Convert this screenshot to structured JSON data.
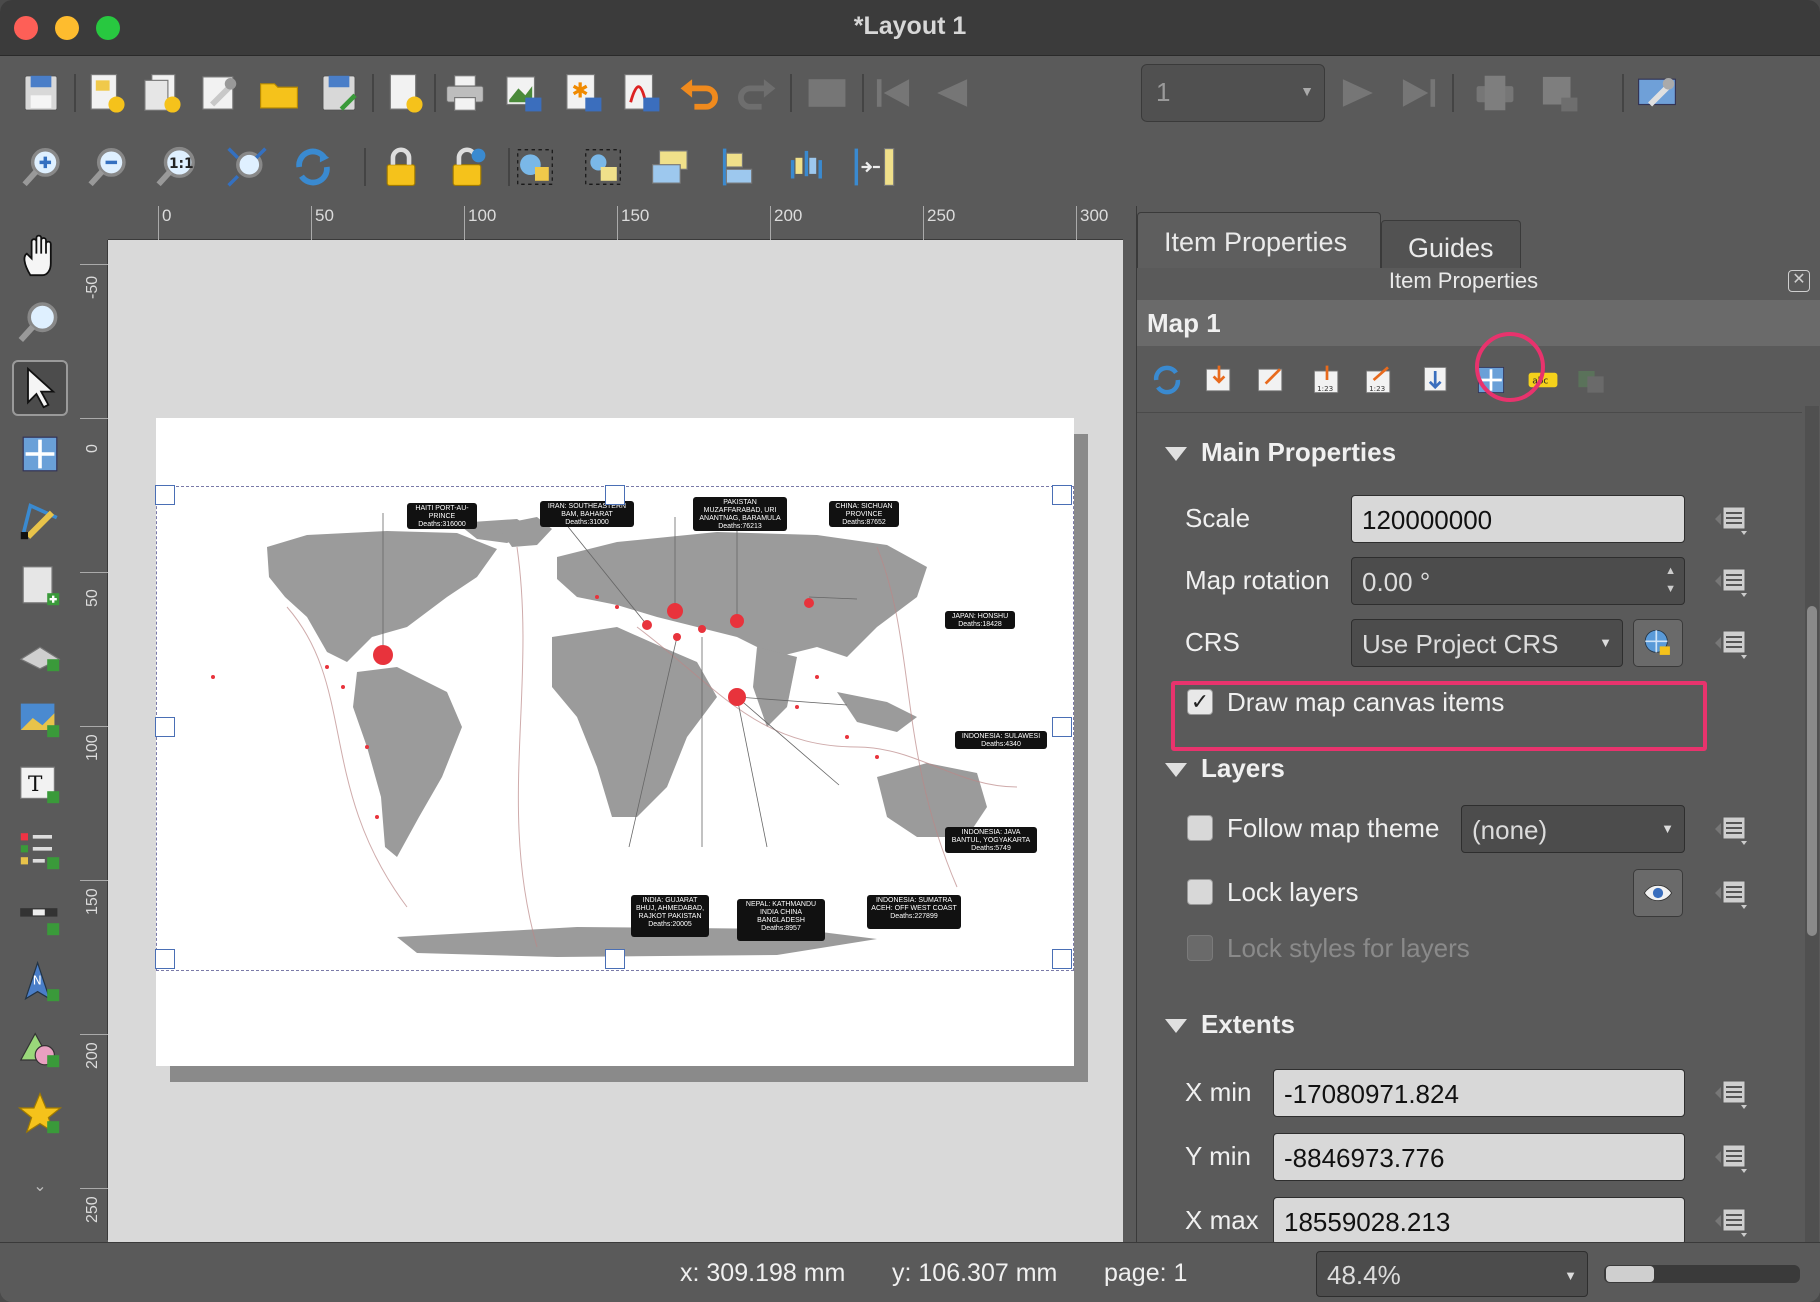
{
  "window": {
    "title": "*Layout 1"
  },
  "ruler_h": [
    "0",
    "50",
    "100",
    "150",
    "200",
    "250",
    "300"
  ],
  "ruler_v": [
    "-50",
    "0",
    "50",
    "100",
    "150",
    "200",
    "250"
  ],
  "page_selector": {
    "value": "1"
  },
  "dock": {
    "tabs": [
      "Item Properties",
      "Guides"
    ],
    "title": "Item Properties",
    "item_name": "Map 1",
    "main_properties": {
      "section": "Main Properties",
      "scale_label": "Scale",
      "scale_value": "120000000",
      "rotation_label": "Map rotation",
      "rotation_value": "0.00 °",
      "crs_label": "CRS",
      "crs_value": "Use Project CRS",
      "draw_canvas_label": "Draw map canvas items"
    },
    "layers": {
      "section": "Layers",
      "follow_theme_label": "Follow map theme",
      "follow_theme_value": "(none)",
      "lock_layers_label": "Lock layers",
      "lock_styles_label": "Lock styles for layers"
    },
    "extents": {
      "section": "Extents",
      "xmin_label": "X min",
      "xmin_value": "-17080971.824",
      "ymin_label": "Y min",
      "ymin_value": "-8846973.776",
      "xmax_label": "X max",
      "xmax_value": "18559028.213"
    }
  },
  "map_labels": [
    "HAITI PORT-AU-PRINCE Deaths:316000",
    "IRAN: SOUTHEASTERN BAM, BAHARAT Deaths:31000",
    "PAKISTAN MUZAFFARABAD, URI ANANTNAG, BARAMULA Deaths:76213",
    "CHINA: SICHUAN PROVINCE Deaths:87652",
    "JAPAN: HONSHU Deaths:18428",
    "INDONESIA: SULAWESI Deaths:4340",
    "INDONESIA: JAVA BANTUL, YOGYAKARTA Deaths:5749",
    "INDONESIA: SUMATRA ACEH: OFF WEST COAST Deaths:227899",
    "NEPAL: KATHMANDU INDIA CHINA BANGLADESH Deaths:8957",
    "INDIA: GUJARAT BHUJ, AHMEDABAD, RAJKOT PAKISTAN Deaths:20005"
  ],
  "status": {
    "x": "x: 309.198 mm",
    "y": "y: 106.307 mm",
    "page": "page: 1",
    "zoom": "48.4%"
  },
  "colors": {
    "highlight": "#e8336d",
    "quake": "#e8333c",
    "land": "#9b9b9b"
  }
}
